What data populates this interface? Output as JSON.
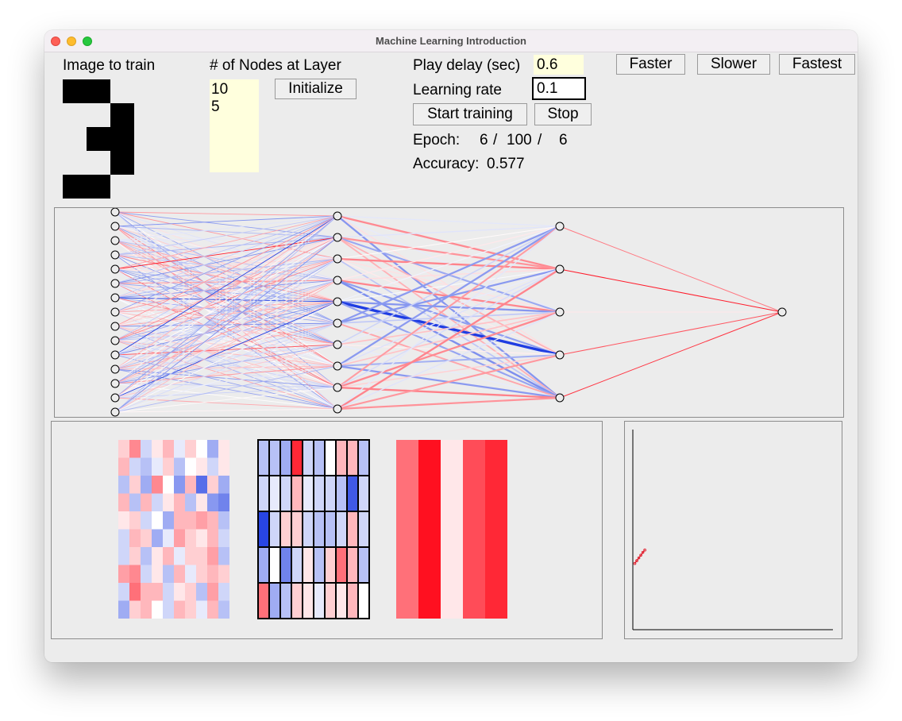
{
  "window": {
    "title": "Machine Learning Introduction"
  },
  "image_section": {
    "label": "Image to train",
    "pixels": [
      [
        1,
        1,
        0
      ],
      [
        0,
        0,
        1
      ],
      [
        0,
        1,
        1
      ],
      [
        0,
        0,
        1
      ],
      [
        1,
        1,
        0
      ]
    ]
  },
  "layers_section": {
    "label": "# of Nodes at Layer",
    "values": [
      "10",
      "5"
    ],
    "initialize_label": "Initialize"
  },
  "controls": {
    "play_delay_label": "Play delay (sec)",
    "play_delay_value": "0.6",
    "learning_rate_label": "Learning rate",
    "learning_rate_value": "0.1",
    "faster_label": "Faster",
    "slower_label": "Slower",
    "fastest_label": "Fastest",
    "start_label": "Start training",
    "stop_label": "Stop",
    "epoch_label": "Epoch:",
    "epoch_current": "6",
    "epoch_total": "100",
    "epoch_last": "6",
    "accuracy_label": "Accuracy:",
    "accuracy_value": "0.577"
  },
  "network": {
    "layer_sizes": [
      15,
      10,
      5,
      1
    ]
  },
  "colors": {
    "positive": "#ff1020",
    "negative": "#1030e0",
    "neutral": "#ffffff"
  },
  "weight_maps": {
    "input_hidden": [
      [
        0.2,
        0.5,
        -0.2,
        0.1,
        0.3,
        -0.1,
        0.2,
        0.0,
        -0.4,
        0.1
      ],
      [
        0.3,
        -0.2,
        -0.3,
        -0.1,
        0.2,
        -0.3,
        0.0,
        0.1,
        -0.2,
        0.1
      ],
      [
        -0.3,
        0.2,
        -0.4,
        0.5,
        0.0,
        -0.5,
        0.3,
        -0.7,
        0.2,
        -0.4
      ],
      [
        0.3,
        -0.3,
        0.3,
        -0.2,
        0.1,
        0.3,
        -0.3,
        0.1,
        -0.5,
        -0.6
      ],
      [
        0.1,
        0.2,
        -0.2,
        0.0,
        -0.4,
        0.3,
        0.3,
        0.4,
        0.3,
        -0.3
      ],
      [
        -0.2,
        0.3,
        0.2,
        -0.4,
        -0.1,
        0.4,
        0.2,
        0.1,
        0.3,
        -0.2
      ],
      [
        -0.2,
        0.2,
        -0.3,
        0.1,
        0.3,
        -0.1,
        0.2,
        0.2,
        0.4,
        -0.3
      ],
      [
        0.4,
        0.5,
        -0.2,
        0.1,
        -0.3,
        0.3,
        -0.1,
        0.2,
        0.3,
        0.2
      ],
      [
        -0.2,
        0.6,
        0.3,
        0.3,
        -0.2,
        0.1,
        0.2,
        -0.3,
        0.4,
        -0.2
      ],
      [
        -0.4,
        0.2,
        0.3,
        0.0,
        -0.2,
        0.3,
        0.2,
        -0.1,
        0.3,
        -0.3
      ]
    ],
    "hidden_output": [
      [
        -0.3,
        -0.3,
        -0.4,
        0.9,
        -0.2,
        -0.3,
        0.0,
        0.3,
        0.3,
        -0.3
      ],
      [
        -0.2,
        -0.1,
        -0.2,
        0.3,
        -0.1,
        -0.2,
        -0.2,
        -0.3,
        -0.8,
        -0.2
      ],
      [
        -0.9,
        -0.2,
        0.2,
        0.2,
        -0.2,
        -0.3,
        -0.3,
        -0.2,
        0.3,
        -0.2
      ],
      [
        -0.4,
        0.0,
        -0.6,
        -0.2,
        0.1,
        -0.3,
        0.2,
        0.6,
        0.3,
        -0.3
      ],
      [
        0.6,
        -0.4,
        -0.3,
        0.2,
        0.1,
        -0.1,
        0.2,
        0.1,
        0.3,
        0.0
      ]
    ],
    "output_weights": [
      0.6,
      1.0,
      0.1,
      0.75,
      0.9
    ]
  },
  "chart_data": {
    "type": "line",
    "x": [
      1,
      2,
      3,
      4,
      5,
      6
    ],
    "y": [
      0.48,
      0.5,
      0.52,
      0.54,
      0.56,
      0.577
    ],
    "xlim": [
      0,
      100
    ],
    "ylim": [
      0,
      1.45
    ]
  }
}
